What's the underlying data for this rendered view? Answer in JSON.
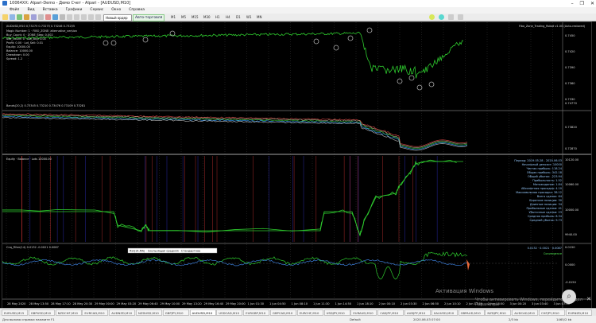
{
  "window": {
    "title": "10064XX: Alpari-Demo - Демо Счет - Alpari - [AUDUSD,M10]",
    "controls": [
      "–",
      "❐",
      "✕"
    ]
  },
  "menu": [
    "Файл",
    "Вид",
    "Вставка",
    "Графики",
    "Сервис",
    "Окно",
    "Справка"
  ],
  "toolbar": {
    "new_order": "Новый ордер",
    "autotrading": "Авто-торговля",
    "timeframes": [
      "M1",
      "M5",
      "M15",
      "M30",
      "H1",
      "H4",
      "D1",
      "W1",
      "MN"
    ]
  },
  "chart": {
    "symbol_label": "AUDUSD,M10  0.73275 0.73275 0.73246 0.73255",
    "ea_label": "Fibo_Zone_Trading_Robot v1.00 (Auto-restored)",
    "info_lines": [
      "Magic Number: 1  · FIBO_ZONE: alternative_version",
      "Buy_Count: 0  · ZONE_Step: 0.002",
      "Sell_Count: 0  · Lot_Buy: 0.01",
      "Profit: 0.00  · Lot_Sell: 0.01",
      "Equity: 10000.00",
      "Balance: 10000.00",
      "Drawdown: 0.00",
      "Spread: 1.2"
    ],
    "price_axis_1": [
      "0.7450",
      "0.7420",
      "0.7390",
      "0.7360",
      "0.7330"
    ],
    "ind2_label": "Bands(20,2) 0.73345 0.73210 0.73476 0.73109 0.73281",
    "ind2_axis": [
      "0.74770",
      "0.73820",
      "0.72870"
    ],
    "ind3_label": "Equity · Balance · Lots  10000.00",
    "ind3_axis": [
      "10120.00",
      "10060.00",
      "10000.00",
      "9940.00"
    ],
    "stats_lines": [
      "Период: 2019.05.28 - 2020.06.03",
      "Начальный депозит: 10000",
      "Чистая прибыль: 118.24",
      "Общая прибыль: 342.18",
      "Общий убыток: -223.94",
      "Прибыльность: 1.52",
      "Матожидание: 1.84",
      "Абсолютная просадка: 4.10",
      "Максимальная просадка: 38.12",
      "Всего сделок: 64",
      "Короткие позиции: 30",
      "Длинные позиции: 34",
      "Прибыльные сделки: 41",
      "Убыточные сделки: 23",
      "Средняя прибыль: 8.34",
      "Средний убыток: 9.73"
    ],
    "ind4_label": "Cnq_Filter(14) 0.0132 -0.0021 0.0087",
    "ind4_right": [
      "0.0132 · 0.0021 · 0.0087",
      "Convergence"
    ],
    "ind4_axis": [
      "0.0150",
      "0.0000",
      "-0.0150"
    ],
    "tooltip": "RSI(14,MA) · Скользящая средняя · Стандартное",
    "time_axis": [
      "28 May 2020",
      "28 May 13:50",
      "28 May 17:10",
      "28 May 20:30",
      "29 May 00:00",
      "29 May 03:20",
      "29 May 06:40",
      "29 May 10:00",
      "29 May 13:20",
      "29 May 16:40",
      "29 May 20:00",
      "1 Jun 01:30",
      "1 Jun 04:50",
      "1 Jun 08:10",
      "1 Jun 11:30",
      "1 Jun 14:50",
      "1 Jun 18:10",
      "2 Jun 00:10",
      "2 Jun 03:30",
      "2 Jun 06:50",
      "2 Jun 10:10",
      "2 Jun 13:30",
      "2 Jun 16:50",
      "3 Jun 00:20",
      "3 Jun 03:40",
      "3 Jun 07:00"
    ]
  },
  "tabs": [
    "EURUSD,M15",
    "GBPUSD,M10",
    "NZDCHF,M10",
    "EURCAD,M10",
    "AUDNZD,M10",
    "NZDUSD,M10",
    "GBPJPY,M10",
    "AUDUSD,M10",
    "USDCAD,M10",
    "EURGBP,M10",
    "GBPCAD,M10",
    "EURCHF,M10",
    "USDJPY,M10",
    "EURAUD,M10",
    "CADJPY,M10",
    "AUDJPY,M10",
    "XAUUSD,M10",
    "GBPAUD,M10",
    "NZDJPY,M10",
    "AUDCAD,M10",
    "CHFJPY,M10",
    "EURNZD,M10"
  ],
  "active_tab": 7,
  "status": {
    "help": "Для вызова справки нажмите F1",
    "profile": "Default",
    "datetime": "2020.06.03 07:00",
    "traffic": "2/3 kb",
    "net": "1465/2 kb"
  },
  "watermark": {
    "line1": "Активация Windows",
    "line2": "Чтобы активировать Windows, перейдите в раздел Параметры"
  }
}
